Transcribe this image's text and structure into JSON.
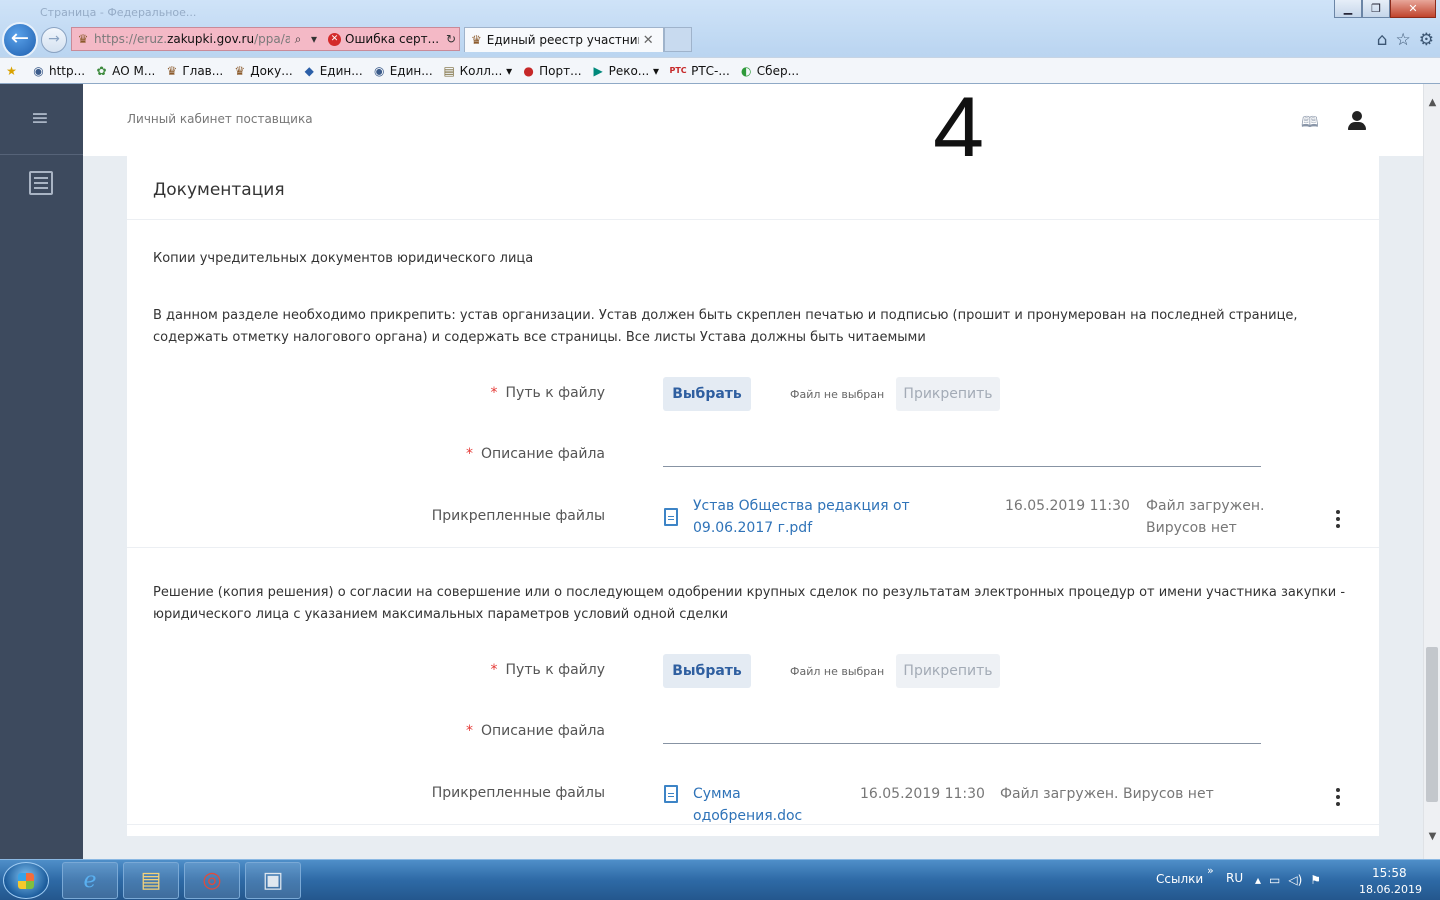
{
  "browser": {
    "ghost_tab": "Страница - Федеральное...",
    "address_url_prefix": "https://eruz.",
    "address_url_domain": "zakupki.gov.ru",
    "address_url_path": "/ppa/app/...",
    "cert_error": "Ошибка серт...",
    "active_tab_title": "Единый реестр участнико...",
    "favorites": [
      {
        "icon": "globe-icon",
        "glyph": "◉",
        "label": "http..."
      },
      {
        "icon": "ao-icon",
        "glyph": "✿",
        "label": "АО М..."
      },
      {
        "icon": "emblem-icon",
        "glyph": "♛",
        "label": "Глав..."
      },
      {
        "icon": "emblem-icon",
        "glyph": "♛",
        "label": "Доку..."
      },
      {
        "icon": "diamond-icon",
        "glyph": "◆",
        "label": "Един..."
      },
      {
        "icon": "globe-icon",
        "glyph": "◉",
        "label": "Един..."
      },
      {
        "icon": "doc-icon",
        "glyph": "▤",
        "label": "Колл..."
      },
      {
        "icon": "flag-icon",
        "glyph": "●",
        "label": "Порт..."
      },
      {
        "icon": "bing-icon",
        "glyph": "▶",
        "label": "Реко..."
      },
      {
        "icon": "rts-icon",
        "glyph": "РТС",
        "label": "РТС-..."
      },
      {
        "icon": "sber-icon",
        "glyph": "◐",
        "label": "Сбер..."
      }
    ]
  },
  "header": {
    "cabinet_title": "Личный кабинет поставщика",
    "big_number": "4"
  },
  "content": {
    "section_title": "Документация",
    "block1": {
      "heading": "Копии учредительных документов юридического лица",
      "description": "В данном разделе необходимо прикрепить: устав организации. Устав должен быть скреплен печатью и подписью (прошит и пронумерован на последней странице, содержать отметку налогового органа) и содержать все страницы. Все листы Устава должны быть читаемыми",
      "path_label": "Путь к файлу",
      "choose_label": "Выбрать",
      "no_file": "Файл не выбран",
      "attach_label": "Прикрепить",
      "desc_label": "Описание файла",
      "attached_label": "Прикрепленные файлы",
      "file_name": "Устав Общества редакция от 09.06.2017 г.pdf",
      "file_date": "16.05.2019 11:30",
      "file_status": "Файл загружен. Вирусов нет"
    },
    "block2": {
      "description": "Решение (копия решения) о согласии на совершение или о последующем одобрении крупных сделок по результатам электронных процедур от имени участника закупки - юридического лица с указанием максимальных параметров условий одной сделки",
      "path_label": "Путь к файлу",
      "choose_label": "Выбрать",
      "no_file": "Файл не выбран",
      "attach_label": "Прикрепить",
      "desc_label": "Описание файла",
      "attached_label": "Прикрепленные файлы",
      "file_name": "Сумма одобрения.doc",
      "file_date": "16.05.2019 11:30",
      "file_status": "Файл загружен. Вирусов нет"
    },
    "required_mark": "*"
  },
  "taskbar": {
    "links": "Ссылки",
    "chevron": "»",
    "lang": "RU",
    "time": "15:58",
    "date": "18.06.2019"
  }
}
